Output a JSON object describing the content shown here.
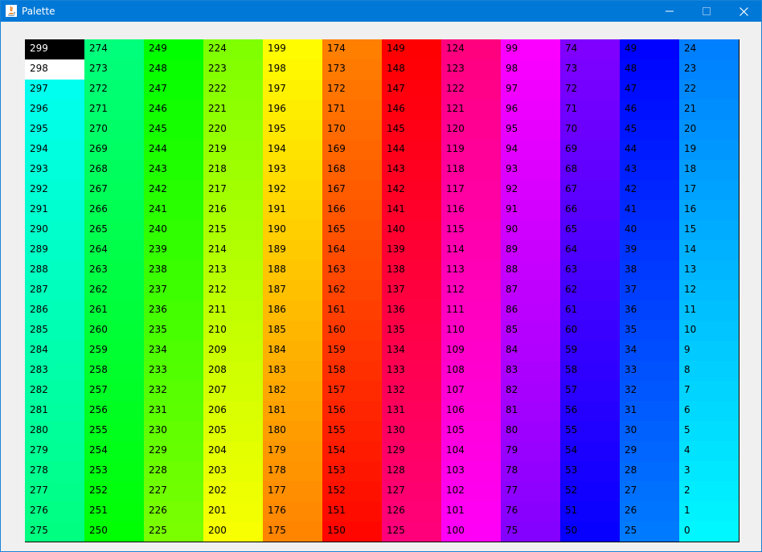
{
  "window": {
    "title": "Palette",
    "app_icon": "java-icon",
    "controls": [
      {
        "name": "minimize-button",
        "icon": "minimize-icon"
      },
      {
        "name": "maximize-button",
        "icon": "maximize-icon"
      },
      {
        "name": "close-button",
        "icon": "close-icon"
      }
    ]
  },
  "palette": {
    "columns": 12,
    "rows": 25,
    "special_colors": {
      "299": "#000000",
      "298": "#ffffff"
    },
    "columns_data": [
      {
        "values": [
          299,
          298,
          297,
          296,
          295,
          294,
          293,
          292,
          291,
          290,
          289,
          288,
          287,
          286,
          285,
          284,
          283,
          282,
          281,
          280,
          279,
          278,
          277,
          276,
          275
        ],
        "colors": [
          "#000000",
          "#ffffff",
          "#00ffee",
          "#00ffe9",
          "#00ffe4",
          "#00ffdf",
          "#00ffda",
          "#00ffd5",
          "#00ffd0",
          "#00ffcb",
          "#00ffc6",
          "#00ffc1",
          "#00ffbc",
          "#00ffb7",
          "#00ffb2",
          "#00ffad",
          "#00ffa8",
          "#00ffa3",
          "#00ff9e",
          "#00ff99",
          "#00ff94",
          "#00ff8f",
          "#00ff8a",
          "#00ff85",
          "#00ff80"
        ]
      },
      {
        "values": [
          274,
          273,
          272,
          271,
          270,
          269,
          268,
          267,
          266,
          265,
          264,
          263,
          262,
          261,
          260,
          259,
          258,
          257,
          256,
          255,
          254,
          253,
          252,
          251,
          250
        ],
        "colors": [
          "#00ff7b",
          "#00ff76",
          "#00ff71",
          "#00ff6c",
          "#00ff67",
          "#00ff62",
          "#00ff5d",
          "#00ff58",
          "#00ff53",
          "#00ff4e",
          "#00ff49",
          "#00ff44",
          "#00ff3f",
          "#00ff3a",
          "#00ff35",
          "#00ff30",
          "#00ff2b",
          "#00ff26",
          "#00ff21",
          "#00ff1c",
          "#00ff17",
          "#00ff12",
          "#00ff0d",
          "#00ff08",
          "#00ff03"
        ]
      },
      {
        "values": [
          249,
          248,
          247,
          246,
          245,
          244,
          243,
          242,
          241,
          240,
          239,
          238,
          237,
          236,
          235,
          234,
          233,
          232,
          231,
          230,
          229,
          228,
          227,
          226,
          225
        ],
        "colors": [
          "#02ff00",
          "#07ff00",
          "#0cff00",
          "#11ff00",
          "#16ff00",
          "#1bff00",
          "#20ff00",
          "#25ff00",
          "#2aff00",
          "#2fff00",
          "#34ff00",
          "#39ff00",
          "#3eff00",
          "#43ff00",
          "#48ff00",
          "#4dff00",
          "#52ff00",
          "#57ff00",
          "#5cff00",
          "#61ff00",
          "#66ff00",
          "#6bff00",
          "#70ff00",
          "#75ff00",
          "#7aff00"
        ]
      },
      {
        "values": [
          224,
          223,
          222,
          221,
          220,
          219,
          218,
          217,
          216,
          215,
          214,
          213,
          212,
          211,
          210,
          209,
          208,
          207,
          206,
          205,
          204,
          203,
          202,
          201,
          200
        ],
        "colors": [
          "#7fff00",
          "#84ff00",
          "#89ff00",
          "#8eff00",
          "#93ff00",
          "#98ff00",
          "#9dff00",
          "#a2ff00",
          "#a7ff00",
          "#acff00",
          "#b1ff00",
          "#b6ff00",
          "#bbff00",
          "#c0ff00",
          "#c5ff00",
          "#caff00",
          "#cfff00",
          "#d4ff00",
          "#d9ff00",
          "#deff00",
          "#e3ff00",
          "#e8ff00",
          "#edff00",
          "#f2ff00",
          "#f7ff00"
        ]
      },
      {
        "values": [
          199,
          198,
          197,
          196,
          195,
          194,
          193,
          192,
          191,
          190,
          189,
          188,
          187,
          186,
          185,
          184,
          183,
          182,
          181,
          180,
          179,
          178,
          177,
          176,
          175
        ],
        "colors": [
          "#fffc00",
          "#fff700",
          "#fff200",
          "#ffed00",
          "#ffe800",
          "#ffe300",
          "#ffde00",
          "#ffd900",
          "#ffd400",
          "#ffcf00",
          "#ffca00",
          "#ffc500",
          "#ffc000",
          "#ffbb00",
          "#ffb600",
          "#ffb100",
          "#ffac00",
          "#ffa700",
          "#ffa200",
          "#ff9d00",
          "#ff9800",
          "#ff9300",
          "#ff8e00",
          "#ff8900",
          "#ff8400"
        ]
      },
      {
        "values": [
          174,
          173,
          172,
          171,
          170,
          169,
          168,
          167,
          166,
          165,
          164,
          163,
          162,
          161,
          160,
          159,
          158,
          157,
          156,
          155,
          154,
          153,
          152,
          151,
          150
        ],
        "colors": [
          "#ff7f00",
          "#ff7a00",
          "#ff7500",
          "#ff7000",
          "#ff6b00",
          "#ff6600",
          "#ff6100",
          "#ff5c00",
          "#ff5700",
          "#ff5200",
          "#ff4d00",
          "#ff4800",
          "#ff4300",
          "#ff3e00",
          "#ff3900",
          "#ff3400",
          "#ff2f00",
          "#ff2a00",
          "#ff2500",
          "#ff2000",
          "#ff1b00",
          "#ff1600",
          "#ff1100",
          "#ff0c00",
          "#ff0700"
        ]
      },
      {
        "values": [
          149,
          148,
          147,
          146,
          145,
          144,
          143,
          142,
          141,
          140,
          139,
          138,
          137,
          136,
          135,
          134,
          133,
          132,
          131,
          130,
          129,
          128,
          127,
          126,
          125
        ],
        "colors": [
          "#ff0002",
          "#ff0007",
          "#ff000c",
          "#ff0011",
          "#ff0016",
          "#ff001b",
          "#ff0020",
          "#ff0025",
          "#ff002a",
          "#ff002f",
          "#ff0034",
          "#ff0039",
          "#ff003e",
          "#ff0043",
          "#ff0048",
          "#ff004d",
          "#ff0052",
          "#ff0057",
          "#ff005c",
          "#ff0061",
          "#ff0066",
          "#ff006b",
          "#ff0070",
          "#ff0075",
          "#ff007a"
        ]
      },
      {
        "values": [
          124,
          123,
          122,
          121,
          120,
          119,
          118,
          117,
          116,
          115,
          114,
          113,
          112,
          111,
          110,
          109,
          108,
          107,
          106,
          105,
          104,
          103,
          102,
          101,
          100
        ],
        "colors": [
          "#ff007f",
          "#ff0084",
          "#ff0089",
          "#ff008e",
          "#ff0093",
          "#ff0098",
          "#ff009d",
          "#ff00a2",
          "#ff00a7",
          "#ff00ac",
          "#ff00b1",
          "#ff00b6",
          "#ff00bb",
          "#ff00c0",
          "#ff00c5",
          "#ff00ca",
          "#ff00cf",
          "#ff00d4",
          "#ff00d9",
          "#ff00de",
          "#ff00e3",
          "#ff00e8",
          "#ff00ed",
          "#ff00f2",
          "#ff00f7"
        ]
      },
      {
        "values": [
          99,
          98,
          97,
          96,
          95,
          94,
          93,
          92,
          91,
          90,
          89,
          88,
          87,
          86,
          85,
          84,
          83,
          82,
          81,
          80,
          79,
          78,
          77,
          76,
          75
        ],
        "colors": [
          "#fc00ff",
          "#f700ff",
          "#f200ff",
          "#ed00ff",
          "#e800ff",
          "#e300ff",
          "#de00ff",
          "#d900ff",
          "#d400ff",
          "#cf00ff",
          "#ca00ff",
          "#c500ff",
          "#c000ff",
          "#bb00ff",
          "#b600ff",
          "#b100ff",
          "#ac00ff",
          "#a700ff",
          "#a200ff",
          "#9d00ff",
          "#9800ff",
          "#9300ff",
          "#8e00ff",
          "#8900ff",
          "#8400ff"
        ]
      },
      {
        "values": [
          74,
          73,
          72,
          71,
          70,
          69,
          68,
          67,
          66,
          65,
          64,
          63,
          62,
          61,
          60,
          59,
          58,
          57,
          56,
          55,
          54,
          53,
          52,
          51,
          50
        ],
        "colors": [
          "#7f00ff",
          "#7a00ff",
          "#7500ff",
          "#7000ff",
          "#6b00ff",
          "#6600ff",
          "#6100ff",
          "#5c00ff",
          "#5700ff",
          "#5200ff",
          "#4d00ff",
          "#4800ff",
          "#4300ff",
          "#3e00ff",
          "#3900ff",
          "#3400ff",
          "#2f00ff",
          "#2a00ff",
          "#2500ff",
          "#2000ff",
          "#1b00ff",
          "#1600ff",
          "#1100ff",
          "#0c00ff",
          "#0700ff"
        ]
      },
      {
        "values": [
          49,
          48,
          47,
          46,
          45,
          44,
          43,
          42,
          41,
          40,
          39,
          38,
          37,
          36,
          35,
          34,
          33,
          32,
          31,
          30,
          29,
          28,
          27,
          26,
          25
        ],
        "colors": [
          "#0002ff",
          "#0007ff",
          "#000cff",
          "#0011ff",
          "#0016ff",
          "#001bff",
          "#0020ff",
          "#0025ff",
          "#002aff",
          "#002fff",
          "#0034ff",
          "#0039ff",
          "#003eff",
          "#0043ff",
          "#0048ff",
          "#004dff",
          "#0052ff",
          "#0057ff",
          "#005cff",
          "#0061ff",
          "#0066ff",
          "#006bff",
          "#0070ff",
          "#0075ff",
          "#007aff"
        ]
      },
      {
        "values": [
          24,
          23,
          22,
          21,
          20,
          19,
          18,
          17,
          16,
          15,
          14,
          13,
          12,
          11,
          10,
          9,
          8,
          7,
          6,
          5,
          4,
          3,
          2,
          1,
          0
        ],
        "colors": [
          "#007fff",
          "#0084ff",
          "#0089ff",
          "#008eff",
          "#0093ff",
          "#0098ff",
          "#009dff",
          "#00a2ff",
          "#00a7ff",
          "#00acff",
          "#00b1ff",
          "#00b6ff",
          "#00bbff",
          "#00c0ff",
          "#00c5ff",
          "#00caff",
          "#00cfff",
          "#00d4ff",
          "#00d9ff",
          "#00deff",
          "#00e3ff",
          "#00e8ff",
          "#00edff",
          "#00f2ff",
          "#00f7ff"
        ]
      }
    ]
  }
}
